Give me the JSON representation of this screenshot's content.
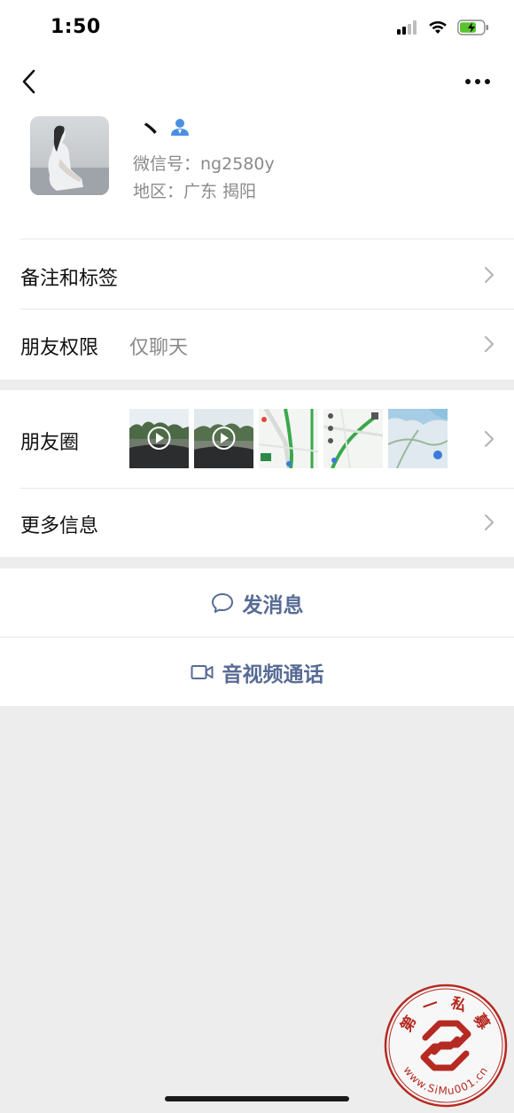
{
  "status_bar": {
    "time": "1:50",
    "icons": [
      "cellular-signal-icon",
      "wifi-icon",
      "battery-charging-icon"
    ],
    "battery_color": "#5ac230"
  },
  "nav": {
    "back_icon": "chevron-left-icon",
    "more_icon": "more-dots-icon"
  },
  "profile": {
    "nickname": "丶",
    "gender_icon": "male-user-icon",
    "gender_icon_color": "#4a90e2",
    "wechat_id": "微信号：ng2580y",
    "region": "地区：广东 揭阳"
  },
  "rows": {
    "remarks_tags": {
      "label": "备注和标签"
    },
    "friend_permissions": {
      "label": "朋友权限",
      "value": "仅聊天"
    },
    "moments": {
      "label": "朋友圈",
      "thumbnails": [
        {
          "kind": "video",
          "icon": "play-icon"
        },
        {
          "kind": "video",
          "icon": "play-icon"
        },
        {
          "kind": "map-screenshot"
        },
        {
          "kind": "map-screenshot"
        },
        {
          "kind": "map-image"
        }
      ]
    },
    "more_info": {
      "label": "更多信息"
    }
  },
  "actions": {
    "send_message": {
      "label": "发消息",
      "icon": "chat-bubble-icon"
    },
    "video_call": {
      "label": "音视频通话",
      "icon": "video-camera-icon"
    }
  },
  "watermark": {
    "top_text": "第 一 私 募",
    "bottom_text": "www.SiMu001.cn",
    "stamp_color": "#b52a22"
  },
  "colors": {
    "link": "#576b95",
    "secondary_text": "#8a8a8a",
    "background": "#ededed"
  }
}
